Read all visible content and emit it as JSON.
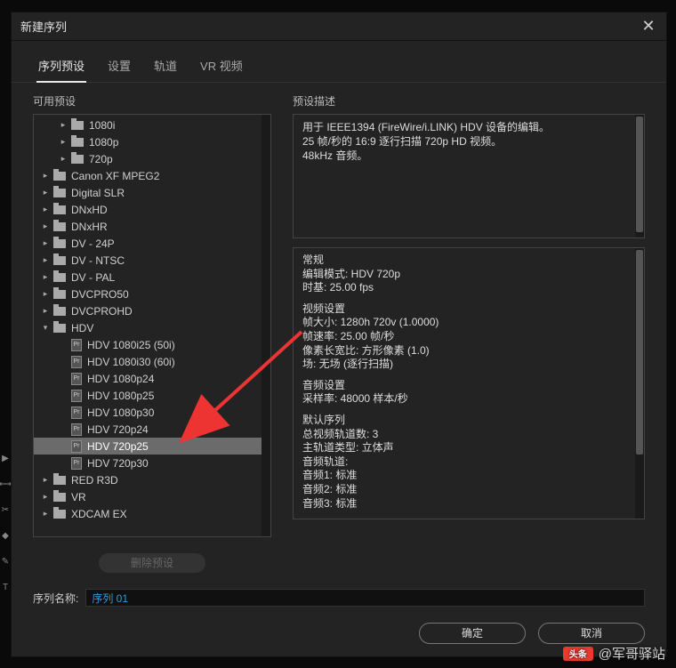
{
  "dialog": {
    "title": "新建序列",
    "tabs": [
      "序列预设",
      "设置",
      "轨道",
      "VR 视频"
    ],
    "active_tab": 0
  },
  "left": {
    "label": "可用预设",
    "tree": [
      {
        "depth": 1,
        "type": "folder",
        "exp": "right",
        "label": "1080i"
      },
      {
        "depth": 1,
        "type": "folder",
        "exp": "right",
        "label": "1080p"
      },
      {
        "depth": 1,
        "type": "folder",
        "exp": "right",
        "label": "720p"
      },
      {
        "depth": 0,
        "type": "folder",
        "exp": "right",
        "label": "Canon XF MPEG2"
      },
      {
        "depth": 0,
        "type": "folder",
        "exp": "right",
        "label": "Digital SLR"
      },
      {
        "depth": 0,
        "type": "folder",
        "exp": "right",
        "label": "DNxHD"
      },
      {
        "depth": 0,
        "type": "folder",
        "exp": "right",
        "label": "DNxHR"
      },
      {
        "depth": 0,
        "type": "folder",
        "exp": "right",
        "label": "DV - 24P"
      },
      {
        "depth": 0,
        "type": "folder",
        "exp": "right",
        "label": "DV - NTSC"
      },
      {
        "depth": 0,
        "type": "folder",
        "exp": "right",
        "label": "DV - PAL"
      },
      {
        "depth": 0,
        "type": "folder",
        "exp": "right",
        "label": "DVCPRO50"
      },
      {
        "depth": 0,
        "type": "folder",
        "exp": "right",
        "label": "DVCPROHD"
      },
      {
        "depth": 0,
        "type": "folder",
        "exp": "down",
        "label": "HDV"
      },
      {
        "depth": 1,
        "type": "preset",
        "label": "HDV 1080i25 (50i)"
      },
      {
        "depth": 1,
        "type": "preset",
        "label": "HDV 1080i30 (60i)"
      },
      {
        "depth": 1,
        "type": "preset",
        "label": "HDV 1080p24"
      },
      {
        "depth": 1,
        "type": "preset",
        "label": "HDV 1080p25"
      },
      {
        "depth": 1,
        "type": "preset",
        "label": "HDV 1080p30"
      },
      {
        "depth": 1,
        "type": "preset",
        "label": "HDV 720p24"
      },
      {
        "depth": 1,
        "type": "preset",
        "label": "HDV 720p25",
        "selected": true
      },
      {
        "depth": 1,
        "type": "preset",
        "label": "HDV 720p30"
      },
      {
        "depth": 0,
        "type": "folder",
        "exp": "right",
        "label": "RED R3D"
      },
      {
        "depth": 0,
        "type": "folder",
        "exp": "right",
        "label": "VR"
      },
      {
        "depth": 0,
        "type": "folder",
        "exp": "right",
        "label": "XDCAM EX"
      }
    ],
    "delete_label": "删除预设"
  },
  "right": {
    "label": "预设描述",
    "desc": [
      "用于 IEEE1394 (FireWire/i.LINK) HDV 设备的编辑。",
      "25 帧/秒的 16:9 逐行扫描 720p HD 视频。",
      "48kHz 音频。"
    ],
    "detail": [
      "常规",
      "编辑模式: HDV 720p",
      "时基: 25.00 fps",
      "",
      "视频设置",
      "帧大小: 1280h 720v (1.0000)",
      "帧速率: 25.00 帧/秒",
      "像素长宽比: 方形像素 (1.0)",
      "场: 无场 (逐行扫描)",
      "",
      "音频设置",
      "采样率: 48000 样本/秒",
      "",
      "默认序列",
      "总视频轨道数: 3",
      "主轨道类型: 立体声",
      "音频轨道:",
      "音频1: 标准",
      "音频2: 标准",
      "音频3: 标准"
    ]
  },
  "name": {
    "label": "序列名称:",
    "value": "序列 01"
  },
  "footer": {
    "ok": "确定",
    "cancel": "取消"
  },
  "watermark": "@军哥驿站"
}
